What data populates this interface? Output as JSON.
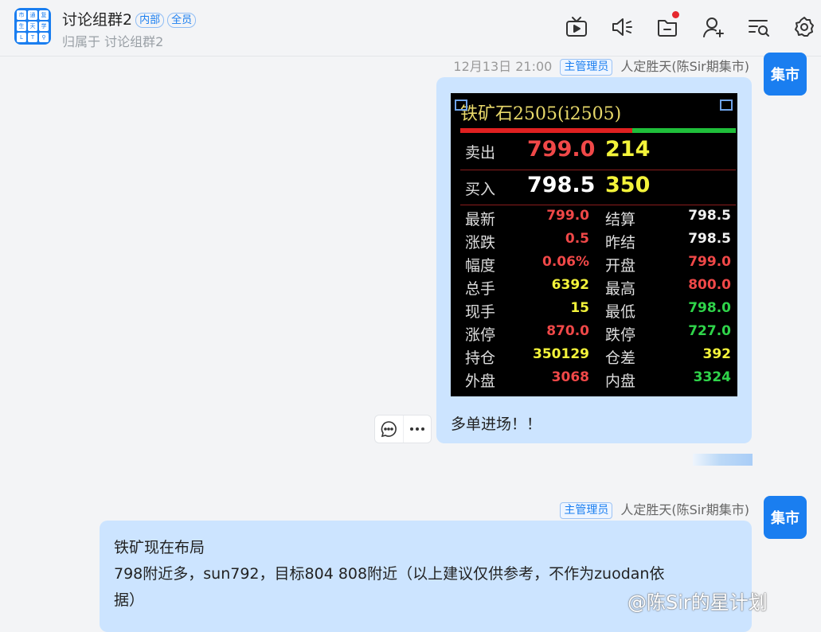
{
  "header": {
    "logo_chars": [
      "市",
      "通",
      "复",
      "生",
      "天",
      "学",
      "L",
      "T",
      "⚲"
    ],
    "title": "讨论组群2",
    "tags": [
      "内部",
      "全员"
    ],
    "subtitle": "归属于 讨论组群2",
    "toolbar": {
      "icons": [
        "tv-icon",
        "speaker-icon",
        "folder-icon",
        "add-user-icon",
        "search-list-icon",
        "gear-icon"
      ]
    }
  },
  "messages": [
    {
      "time": "12月13日 21:00",
      "role": "主管理员",
      "sender": "人定胜天(陈Sir期集市)",
      "avatar_text": "集市",
      "text": "多单进场！！",
      "quote_image": {
        "title": "铁矿石2505(i2505)",
        "ask_label": "卖出",
        "ask_price": "799.0",
        "ask_vol": "214",
        "bid_label": "买入",
        "bid_price": "798.5",
        "bid_vol": "350",
        "rows": [
          {
            "l1": "最新",
            "v1": "799.0",
            "c1": "#f04848",
            "l2": "结算",
            "v2": "798.5",
            "c2": "#f0f0f0"
          },
          {
            "l1": "涨跌",
            "v1": "0.5",
            "c1": "#f04848",
            "l2": "昨结",
            "v2": "798.5",
            "c2": "#f0f0f0"
          },
          {
            "l1": "幅度",
            "v1": "0.06%",
            "c1": "#f04848",
            "l2": "开盘",
            "v2": "799.0",
            "c2": "#f04848"
          },
          {
            "l1": "总手",
            "v1": "6392",
            "c1": "#f3f33a",
            "l2": "最高",
            "v2": "800.0",
            "c2": "#f04848"
          },
          {
            "l1": "现手",
            "v1": "15",
            "c1": "#f3f33a",
            "l2": "最低",
            "v2": "798.0",
            "c2": "#2fd44a"
          },
          {
            "l1": "涨停",
            "v1": "870.0",
            "c1": "#f04848",
            "l2": "跌停",
            "v2": "727.0",
            "c2": "#2fd44a"
          },
          {
            "l1": "持仓",
            "v1": "350129",
            "c1": "#f3f33a",
            "l2": "仓差",
            "v2": "392",
            "c2": "#f3f33a"
          },
          {
            "l1": "外盘",
            "v1": "3068",
            "c1": "#f04848",
            "l2": "内盘",
            "v2": "3324",
            "c2": "#2fd44a"
          }
        ]
      }
    },
    {
      "role": "主管理员",
      "sender": "人定胜天(陈Sir期集市)",
      "avatar_text": "集市",
      "lines": [
        "铁矿现在布局",
        "798附近多，sun792，目标804 808附近（以上建议仅供参考，不作为zuodan依",
        "据）"
      ]
    }
  ],
  "watermark": "@陈Sir的星计划",
  "colors": {
    "accent": "#1a7ef0",
    "bubble": "#cce4ff",
    "ask_price": "#f04848",
    "bid_price": "#ffffff"
  }
}
